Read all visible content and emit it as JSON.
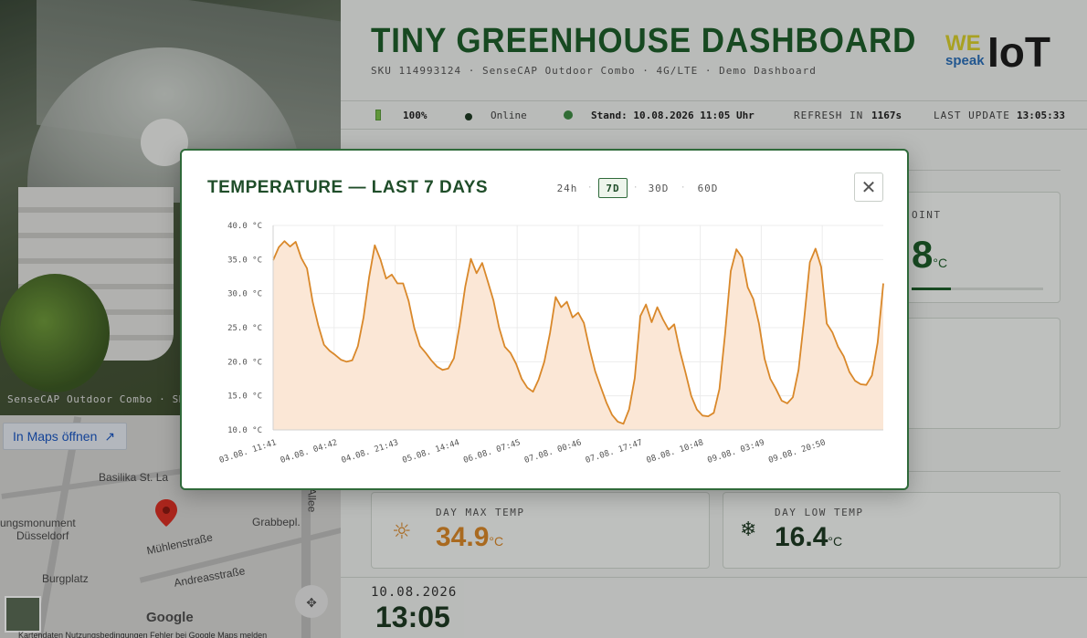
{
  "camera": {
    "caption": "SenseCAP Outdoor Combo · SKU"
  },
  "map": {
    "open_button": "In Maps öffnen",
    "labels": [
      "Basilika St. La",
      "ungsmonument",
      "Düsseldorf",
      "Mühlenstraße",
      "Grabbepl.",
      "Andreasstraße",
      "Burgplatz",
      "Allee"
    ],
    "google": "Google",
    "footer": "Kartendaten   Nutzungsbedingungen   Fehler bei Google Maps melden"
  },
  "dashboard": {
    "title": "TINY GREENHOUSE DASHBOARD",
    "subtitle": "SKU 114993124 · SenseCAP Outdoor Combo · 4G/LTE · Demo Dashboard",
    "logo": {
      "we": "WE",
      "speak": "speak",
      "iot": "IoT"
    },
    "status": {
      "battery": "100%",
      "online": "Online",
      "stand": "Stand: 10.08.2026 11:05 Uhr",
      "refresh_label": "REFRESH IN",
      "refresh_value": "1167s",
      "last_update_label": "LAST UPDATE",
      "last_update_value": "13:05:33"
    },
    "dew_point": {
      "label": "OINT",
      "value": "8",
      "unit": "°C"
    },
    "day_max": {
      "label": "DAY MAX TEMP",
      "value": "34.9",
      "unit": "°C",
      "icon": "sun-icon"
    },
    "day_low": {
      "label": "DAY LOW TEMP",
      "value": "16.4",
      "unit": "°C",
      "icon": "snowflake-icon"
    },
    "date": "10.08.2026",
    "time": "13:05"
  },
  "modal": {
    "title": "TEMPERATURE — LAST 7 DAYS",
    "ranges": [
      "24h",
      "7D",
      "30D",
      "60D"
    ],
    "active_range": "7D",
    "close_icon": "close-icon"
  },
  "colors": {
    "line": "#d9882a",
    "fill": "#fbe7d6",
    "accent": "#1e5e2b",
    "max_temp": "#d9882a"
  },
  "chart_data": {
    "type": "area",
    "title": "TEMPERATURE — LAST 7 DAYS",
    "xlabel": "",
    "ylabel": "",
    "y_ticks": [
      "40.0 °C",
      "35.0 °C",
      "30.0 °C",
      "25.0 °C",
      "20.0 °C",
      "15.0 °C",
      "10.0 °C"
    ],
    "ylim": [
      10,
      40
    ],
    "x_ticks": [
      "03.08. 11:41",
      "04.08. 04:42",
      "04.08. 21:43",
      "05.08. 14:44",
      "06.08. 07:45",
      "07.08. 00:46",
      "07.08. 17:47",
      "08.08. 10:48",
      "09.08. 03:49",
      "09.08. 20:50"
    ],
    "grid": true,
    "series": [
      {
        "values": [
          34.9,
          36.8,
          37.7,
          36.9,
          37.6,
          35.2,
          33.7,
          28.8,
          25.3,
          22.5,
          21.6,
          21.0,
          20.3,
          20.0,
          20.2,
          22.3,
          26.5,
          32.4,
          37.1,
          35.0,
          32.2,
          32.8,
          31.5,
          31.5,
          28.9,
          24.9,
          22.3,
          21.3,
          20.2,
          19.3,
          18.8,
          19.0,
          20.5,
          25.3,
          31.0,
          35.1,
          33.0,
          34.5,
          31.8,
          29.0,
          25.0,
          22.2,
          21.3,
          19.7,
          17.5,
          16.2,
          15.6,
          17.4,
          20.0,
          24.2,
          29.5,
          28.0,
          28.8,
          26.5,
          27.2,
          25.7,
          21.9,
          18.6,
          16.3,
          14.0,
          12.2,
          11.2,
          10.9,
          13.0,
          17.6,
          26.7,
          28.4,
          25.8,
          28.0,
          26.2,
          24.7,
          25.5,
          21.6,
          18.4,
          15.0,
          13.0,
          12.1,
          12.0,
          12.5,
          16.0,
          24.1,
          33.3,
          36.5,
          35.3,
          30.9,
          29.2,
          25.6,
          20.4,
          17.5,
          16.0,
          14.3,
          13.9,
          14.8,
          18.8,
          26.3,
          34.6,
          36.6,
          33.9,
          25.6,
          24.3,
          22.2,
          20.8,
          18.5,
          17.2,
          16.7,
          16.6,
          18.0,
          22.8,
          31.5
        ]
      }
    ]
  }
}
